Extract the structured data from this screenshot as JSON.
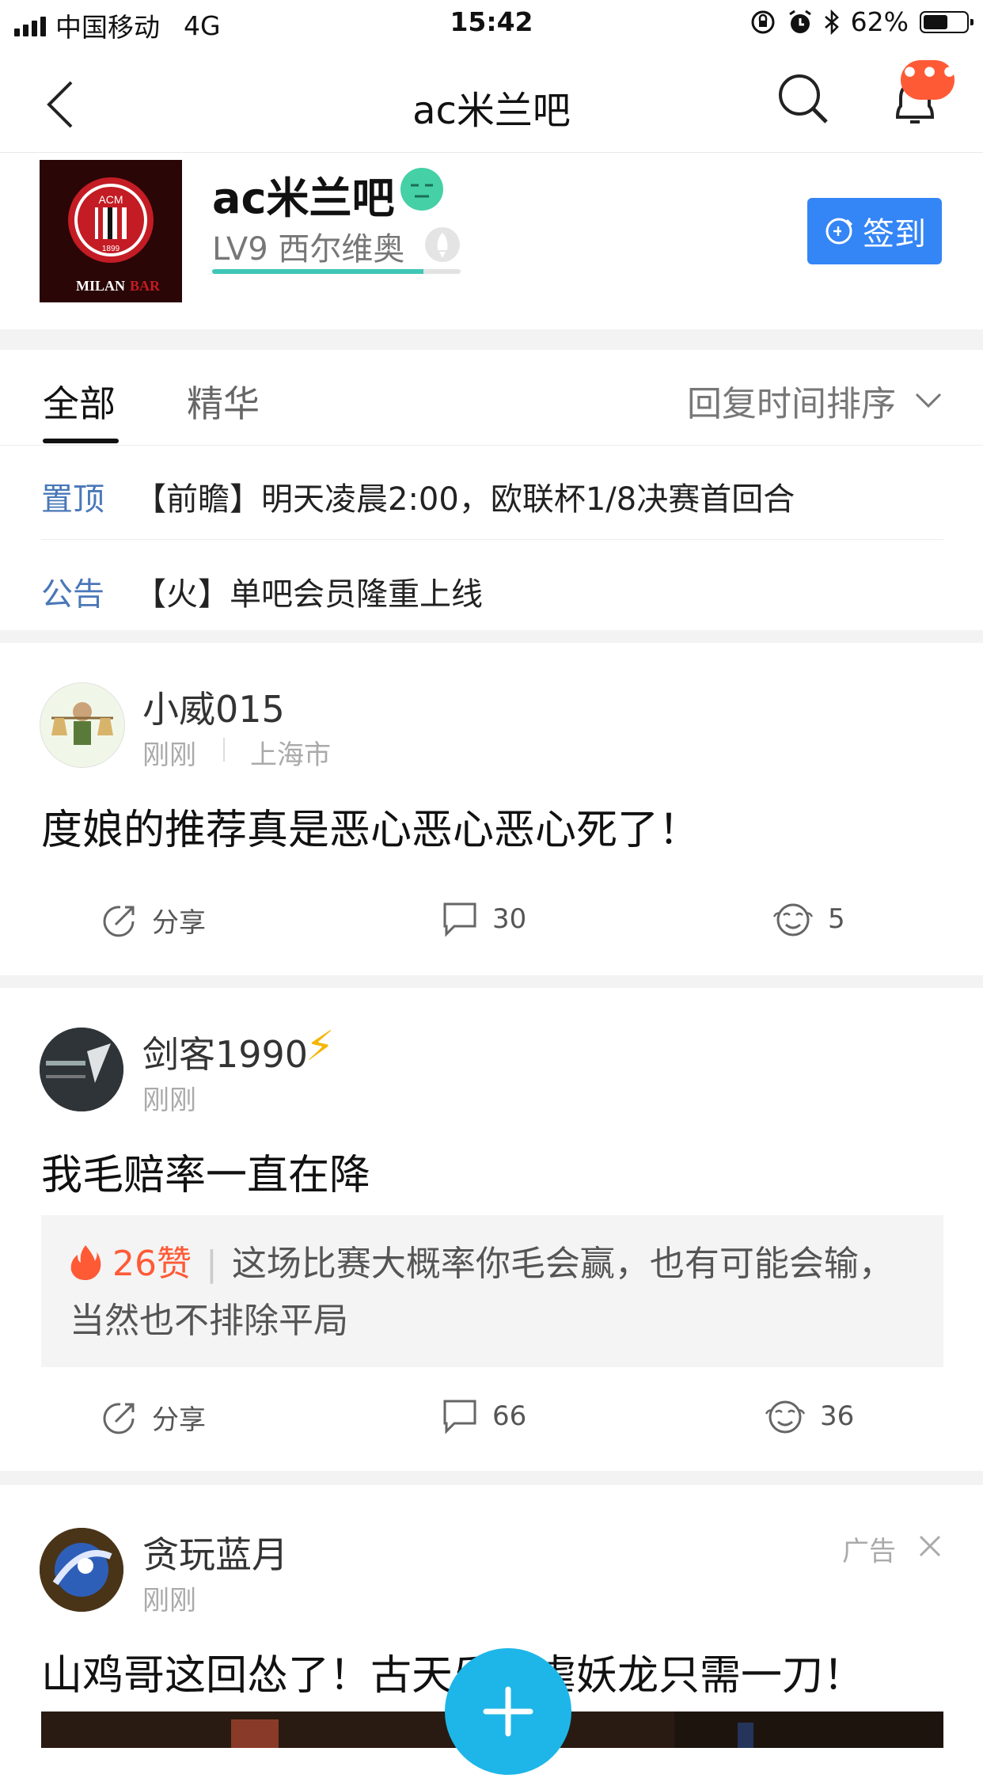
{
  "status_bar": {
    "carrier": "中国移动",
    "network": "4G",
    "time": "15:42",
    "battery": "62%",
    "battery_level": 0.62
  },
  "nav": {
    "title": "ac米兰吧",
    "badge": "•••"
  },
  "forum": {
    "name": "ac米兰吧",
    "level": "LV9 西尔维奥",
    "level_progress": 0.85,
    "signin_label": "签到",
    "logo_text_top": "ACM",
    "logo_year": "1899",
    "logo_text_a": "MILAN",
    "logo_text_b": "BAR"
  },
  "tabs": {
    "all": "全部",
    "featured": "精华",
    "sort": "回复时间排序"
  },
  "notices": [
    {
      "tag": "置顶",
      "text": "【前瞻】明天凌晨2:00，欧联杯1/8决赛首回合"
    },
    {
      "tag": "公告",
      "text": "【火】单吧会员隆重上线"
    }
  ],
  "posts": [
    {
      "username": "小威015",
      "time": "刚刚",
      "location": "上海市",
      "title": "度娘的推荐真是恶心恶心恶心死了！",
      "share": "分享",
      "comments": "30",
      "likes": "5"
    },
    {
      "username": "剑客1990",
      "badge": "⚡",
      "time": "刚刚",
      "title": "我毛赔率一直在降",
      "quote_hot": "26赞",
      "quote_text": "这场比赛大概率你毛会赢，也有可能会输， 当然也不排除平局",
      "share": "分享",
      "comments": "66",
      "likes": "36"
    },
    {
      "username": "贪玩蓝月",
      "time": "刚刚",
      "ad_label": "广告",
      "title": "山鸡哥这回怂了！古天乐完虐妖龙只需一刀！"
    }
  ],
  "colors": {
    "accent_blue": "#3485f6",
    "hot_orange": "#ff5a36",
    "fab": "#1eb6e8",
    "notice_tag": "#4a78b8"
  }
}
